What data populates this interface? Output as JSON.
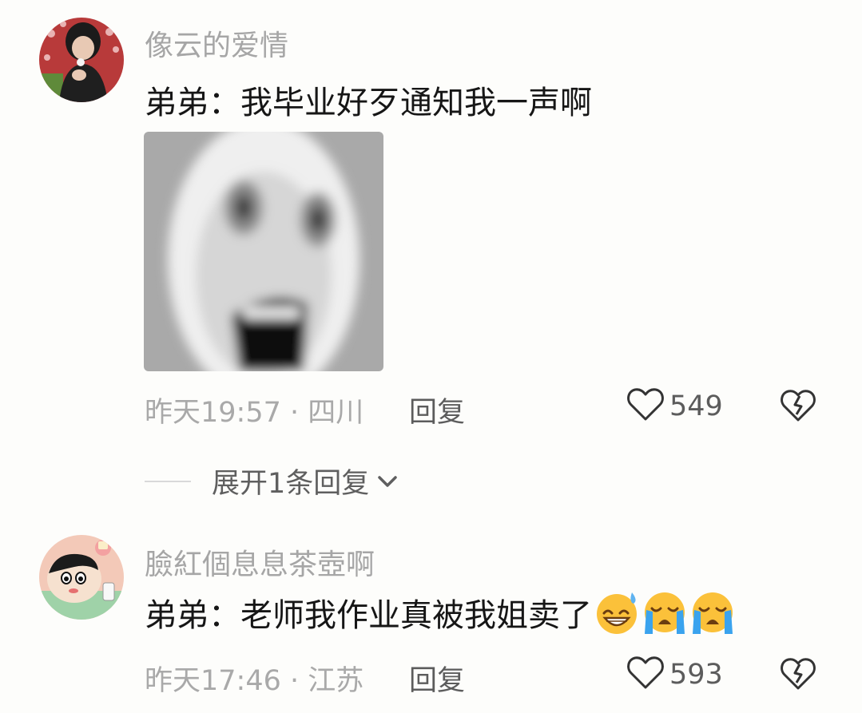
{
  "comments": [
    {
      "username": "像云的爱情",
      "text": "弟弟：我毕业好歹通知我一声啊",
      "time": "昨天19:57",
      "location": "四川",
      "reply_label": "回复",
      "likes": "549",
      "expand_label": "展开1条回复",
      "image": "meme-face-image"
    },
    {
      "username": "臉紅個息息茶壺啊",
      "text": "弟弟：老师我作业真被我姐卖了",
      "emojis": [
        "grinning-sweat-emoji",
        "loudly-crying-emoji",
        "loudly-crying-emoji"
      ],
      "time": "昨天17:46",
      "location": "江苏",
      "reply_label": "回复",
      "likes": "593"
    }
  ],
  "separator": " · ",
  "colors": {
    "background": "#fdfdfb",
    "username": "#a6a6a6",
    "text": "#161616",
    "meta": "#a9a9a9",
    "action": "#5c5c5c"
  }
}
